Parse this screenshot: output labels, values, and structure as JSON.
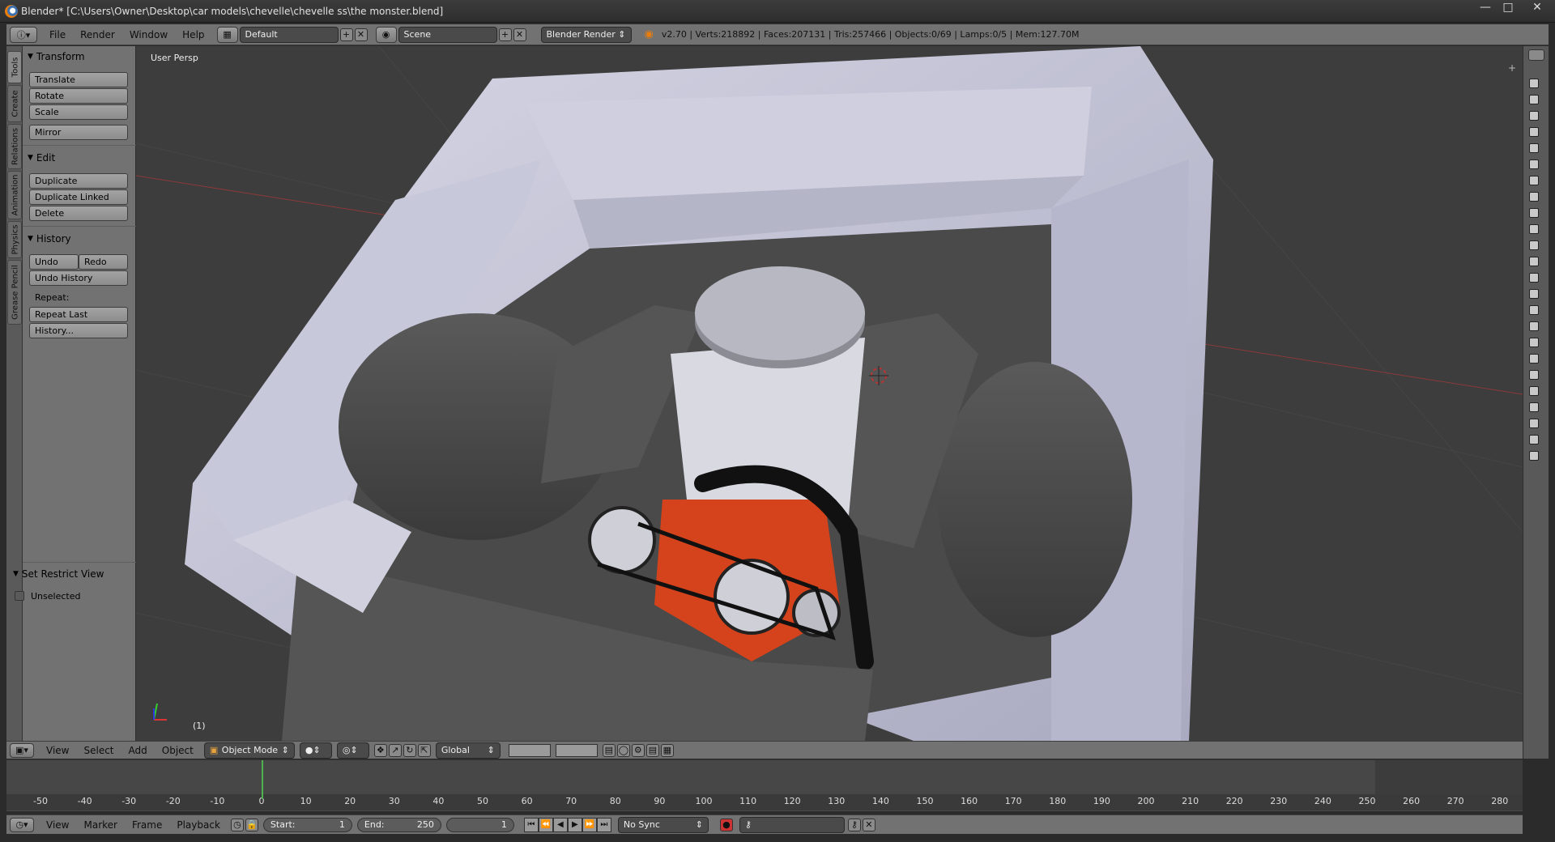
{
  "window": {
    "title": "Blender* [C:\\Users\\Owner\\Desktop\\car models\\chevelle\\chevelle ss\\the monster.blend]",
    "buttons": [
      "minimize",
      "maximize",
      "close"
    ]
  },
  "info_header": {
    "menus": [
      "File",
      "Render",
      "Window",
      "Help"
    ],
    "layout": "Default",
    "scene": "Scene",
    "engine": "Blender Render",
    "stats": "v2.70 | Verts:218892 | Faces:207131 | Tris:257466 | Objects:0/69 | Lamps:0/5 | Mem:127.70M"
  },
  "tool_tabs": [
    "Tools",
    "Create",
    "Relations",
    "Animation",
    "Physics",
    "Grease Pencil"
  ],
  "toolshelf": {
    "transform": {
      "title": "Transform",
      "buttons": [
        "Translate",
        "Rotate",
        "Scale",
        "Mirror"
      ]
    },
    "edit": {
      "title": "Edit",
      "buttons": [
        "Duplicate",
        "Duplicate Linked",
        "Delete"
      ]
    },
    "history": {
      "title": "History",
      "undo": "Undo",
      "redo": "Redo",
      "undo_history": "Undo History",
      "repeat_label": "Repeat:",
      "repeat_last": "Repeat Last",
      "history_btn": "History..."
    },
    "restrict": {
      "title": "Set Restrict View",
      "checkbox": "Unselected"
    }
  },
  "viewport": {
    "view_label": "User Persp",
    "frame_label": "(1)"
  },
  "view_header": {
    "menus": [
      "View",
      "Select",
      "Add",
      "Object"
    ],
    "mode": "Object Mode",
    "orientation": "Global"
  },
  "timeline": {
    "ticks": [
      "-50",
      "-40",
      "-30",
      "-20",
      "-10",
      "0",
      "10",
      "20",
      "30",
      "40",
      "50",
      "60",
      "70",
      "80",
      "90",
      "100",
      "110",
      "120",
      "130",
      "140",
      "150",
      "160",
      "170",
      "180",
      "190",
      "200",
      "210",
      "220",
      "230",
      "240",
      "250",
      "260",
      "270",
      "280"
    ],
    "current_frame_tick": "0"
  },
  "time_header": {
    "menus": [
      "View",
      "Marker",
      "Frame",
      "Playback"
    ],
    "start_label": "Start:",
    "start_value": "1",
    "end_label": "End:",
    "end_value": "250",
    "current": "1",
    "sync": "No Sync"
  },
  "colors": {
    "engine_block": "#d4431b",
    "body_paint": "#c8c8da",
    "timeline_cursor": "#4fb04f"
  }
}
